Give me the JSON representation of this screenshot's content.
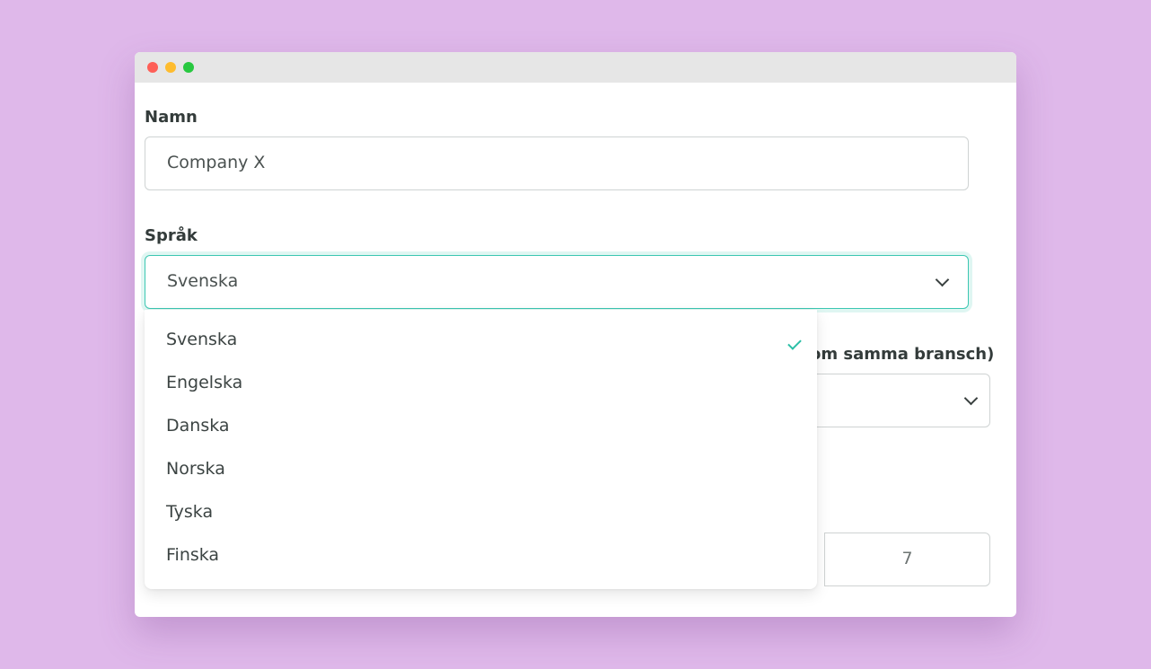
{
  "form": {
    "name_label": "Namn",
    "name_value": "Company X",
    "language_label": "Språk",
    "language_value": "Svenska",
    "hidden_label_tail": "om samma bransch)",
    "number_value": "7"
  },
  "dropdown": {
    "options": [
      {
        "label": "Svenska",
        "selected": true
      },
      {
        "label": "Engelska",
        "selected": false
      },
      {
        "label": "Danska",
        "selected": false
      },
      {
        "label": "Norska",
        "selected": false
      },
      {
        "label": "Tyska",
        "selected": false
      },
      {
        "label": "Finska",
        "selected": false
      }
    ]
  },
  "colors": {
    "background": "#dfb8ea",
    "accent": "#2bbfa6",
    "titlebar": "#e6e6e6"
  },
  "icons": {
    "dropdown": "chevron-down-icon",
    "selected": "check-icon"
  }
}
